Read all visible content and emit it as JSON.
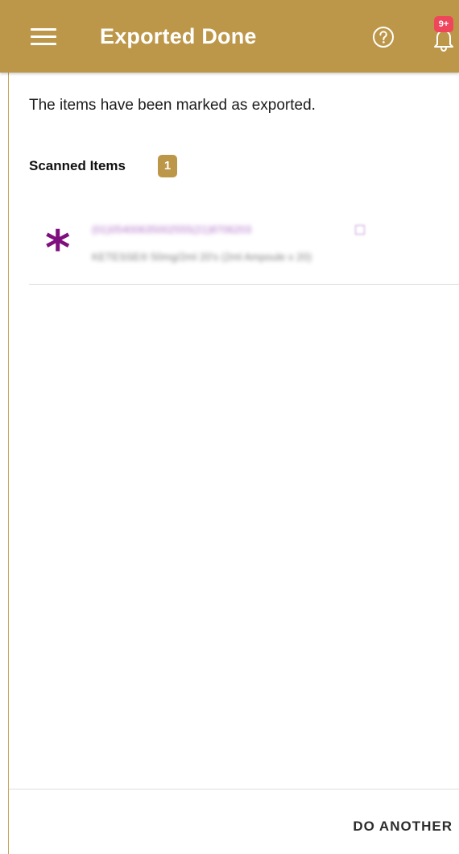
{
  "header": {
    "title": "Exported Done",
    "menu_icon": "menu-icon",
    "help_icon": "help-circle-icon",
    "notification_icon": "bell-icon",
    "notification_badge": "9+"
  },
  "main": {
    "message": "The items have been marked as exported.",
    "section_title": "Scanned Items",
    "count": "1",
    "items": [
      {
        "icon": "asterisk-icon",
        "code": "(01)05400635002555(21)8706203",
        "description": "KETESSE® 50mg/2ml 20's (2ml Ampoule x 20)"
      }
    ]
  },
  "footer": {
    "button_label": "DO ANOTHER"
  },
  "colors": {
    "brand": "#bd9749",
    "badge_alert": "#f0465b",
    "item_glyph": "#7f0f7f",
    "item_code": "#a35ac0"
  }
}
